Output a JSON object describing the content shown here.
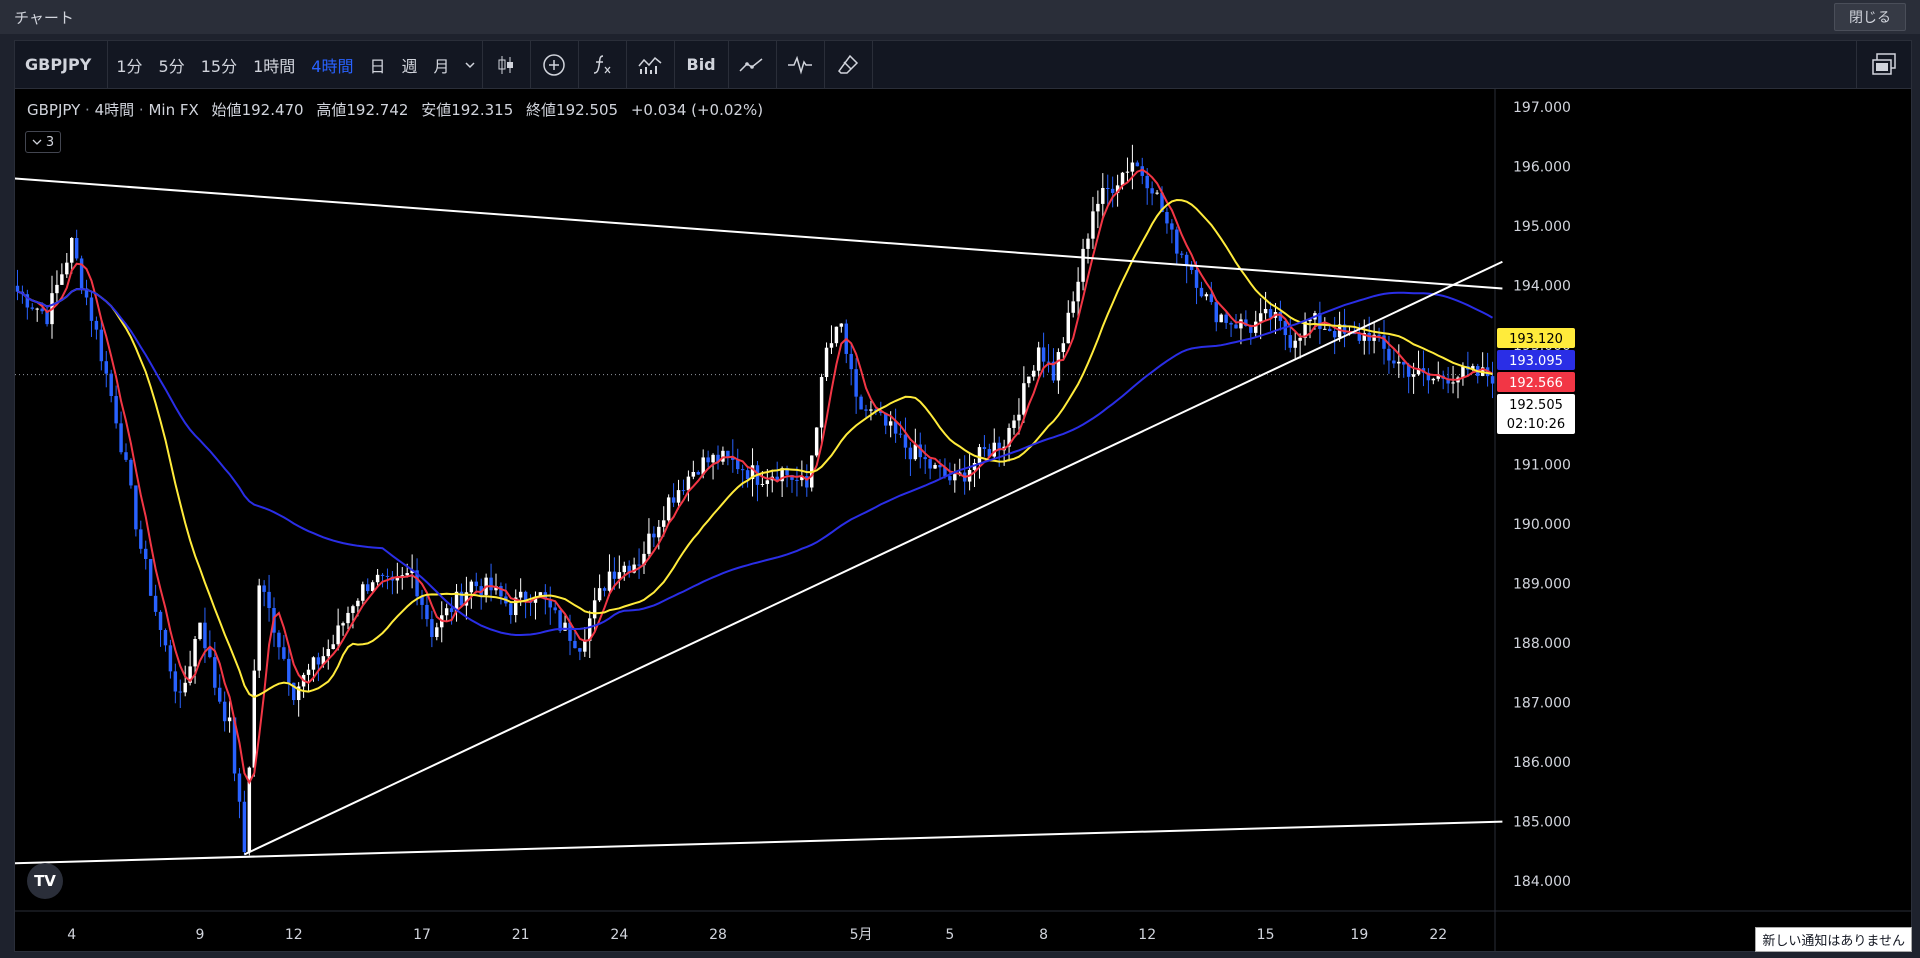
{
  "window": {
    "title": "チャート",
    "close_label": "閉じる"
  },
  "toolbar": {
    "symbol": "GBPJPY",
    "intervals": [
      "1分",
      "5分",
      "15分",
      "1時間",
      "4時間",
      "日",
      "週",
      "月"
    ],
    "active_interval": "4時間",
    "bid_label": "Bid",
    "icons": [
      "chevron-down-icon",
      "candlestick-icon",
      "plus-circle-icon",
      "function-icon",
      "indicators-icon",
      "line-tool-icon",
      "waveform-icon",
      "eraser-icon",
      "layout-icon"
    ]
  },
  "legend": {
    "symbol": "GBPJPY",
    "interval": "4時間",
    "source": "Min FX",
    "open_label": "始値",
    "open": "192.470",
    "high_label": "高値",
    "high": "192.742",
    "low_label": "安値",
    "low": "192.315",
    "close_label": "終値",
    "close": "192.505",
    "change": "+0.034 (+0.02%)",
    "collapse_count": "3"
  },
  "logo_text": "TV",
  "notification": "新しい通知はありません",
  "chart_data": {
    "type": "candlestick",
    "symbol": "GBPJPY",
    "ylim": [
      183.5,
      197.3
    ],
    "y_ticks": [
      184.0,
      185.0,
      186.0,
      187.0,
      188.0,
      189.0,
      190.0,
      191.0,
      192.0,
      193.0,
      194.0,
      195.0,
      196.0,
      197.0
    ],
    "y_tick_labels": [
      "184.000",
      "185.000",
      "186.000",
      "187.000",
      "188.000",
      "189.000",
      "190.000",
      "191.000",
      "192.000",
      "193.000",
      "194.000",
      "195.000",
      "196.000",
      "197.000"
    ],
    "x_tick_labels": [
      "4",
      "9",
      "12",
      "17",
      "21",
      "24",
      "28",
      "5月",
      "5",
      "8",
      "12",
      "15",
      "19",
      "22"
    ],
    "x_tick_bars": [
      11,
      37,
      56,
      82,
      102,
      122,
      142,
      171,
      189,
      208,
      229,
      253,
      272,
      288
    ],
    "bar_count": 300,
    "price_labels": [
      {
        "value": 193.12,
        "label": "193.120",
        "color": "#ffeb3b",
        "text_color": "#000000"
      },
      {
        "value": 193.095,
        "label": "193.095",
        "color": "#2a2ee6",
        "text_color": "#ffffff"
      },
      {
        "value": 192.566,
        "label": "192.566",
        "color": "#f23645",
        "text_color": "#ffffff"
      },
      {
        "value": 192.505,
        "label": "192.505",
        "sub": "02:10:26",
        "color": "#ffffff",
        "text_color": "#000000"
      }
    ],
    "key_points": [
      [
        0,
        193.9
      ],
      [
        6,
        193.5
      ],
      [
        11,
        194.7
      ],
      [
        16,
        193.2
      ],
      [
        20,
        191.8
      ],
      [
        25,
        189.6
      ],
      [
        29,
        188.2
      ],
      [
        33,
        187.0
      ],
      [
        37,
        188.4
      ],
      [
        40,
        187.3
      ],
      [
        43,
        186.6
      ],
      [
        46,
        184.5
      ],
      [
        49,
        189.0
      ],
      [
        52,
        188.3
      ],
      [
        56,
        187.2
      ],
      [
        60,
        187.6
      ],
      [
        64,
        188.0
      ],
      [
        68,
        188.7
      ],
      [
        72,
        189.1
      ],
      [
        76,
        188.9
      ],
      [
        80,
        189.2
      ],
      [
        84,
        188.2
      ],
      [
        88,
        188.6
      ],
      [
        92,
        189.0
      ],
      [
        96,
        188.9
      ],
      [
        100,
        188.6
      ],
      [
        105,
        188.9
      ],
      [
        110,
        188.3
      ],
      [
        114,
        188.0
      ],
      [
        120,
        189.2
      ],
      [
        126,
        189.4
      ],
      [
        132,
        190.4
      ],
      [
        138,
        191.0
      ],
      [
        142,
        191.1
      ],
      [
        146,
        191.0
      ],
      [
        150,
        190.8
      ],
      [
        155,
        190.9
      ],
      [
        160,
        190.6
      ],
      [
        164,
        192.9
      ],
      [
        167,
        193.3
      ],
      [
        170,
        192.0
      ],
      [
        174,
        191.8
      ],
      [
        180,
        191.3
      ],
      [
        186,
        190.9
      ],
      [
        190,
        190.7
      ],
      [
        196,
        191.2
      ],
      [
        200,
        191.4
      ],
      [
        204,
        192.2
      ],
      [
        207,
        193.0
      ],
      [
        210,
        192.5
      ],
      [
        214,
        193.7
      ],
      [
        218,
        195.3
      ],
      [
        222,
        195.7
      ],
      [
        226,
        196.1
      ],
      [
        230,
        195.7
      ],
      [
        234,
        194.8
      ],
      [
        238,
        194.3
      ],
      [
        242,
        193.6
      ],
      [
        246,
        193.4
      ],
      [
        250,
        193.3
      ],
      [
        254,
        193.5
      ],
      [
        258,
        193.1
      ],
      [
        262,
        193.4
      ],
      [
        266,
        193.3
      ],
      [
        270,
        193.1
      ],
      [
        274,
        193.2
      ],
      [
        278,
        192.8
      ],
      [
        282,
        192.6
      ],
      [
        286,
        192.4
      ],
      [
        290,
        192.5
      ],
      [
        299,
        192.5
      ]
    ],
    "moving_averages": [
      {
        "period": 5,
        "color": "#f23645"
      },
      {
        "period": 20,
        "color": "#ffeb3b"
      },
      {
        "period": 75,
        "color": "#2a2ee6"
      }
    ],
    "trendlines": [
      {
        "points": [
          [
            -1,
            195.8
          ],
          [
            301,
            193.95
          ]
        ],
        "color": "#ffffff"
      },
      {
        "points": [
          [
            46,
            184.45
          ],
          [
            301,
            194.4
          ]
        ],
        "color": "#ffffff"
      },
      {
        "points": [
          [
            -1,
            184.3
          ],
          [
            301,
            185.0
          ]
        ],
        "color": "#ffffff"
      }
    ]
  }
}
